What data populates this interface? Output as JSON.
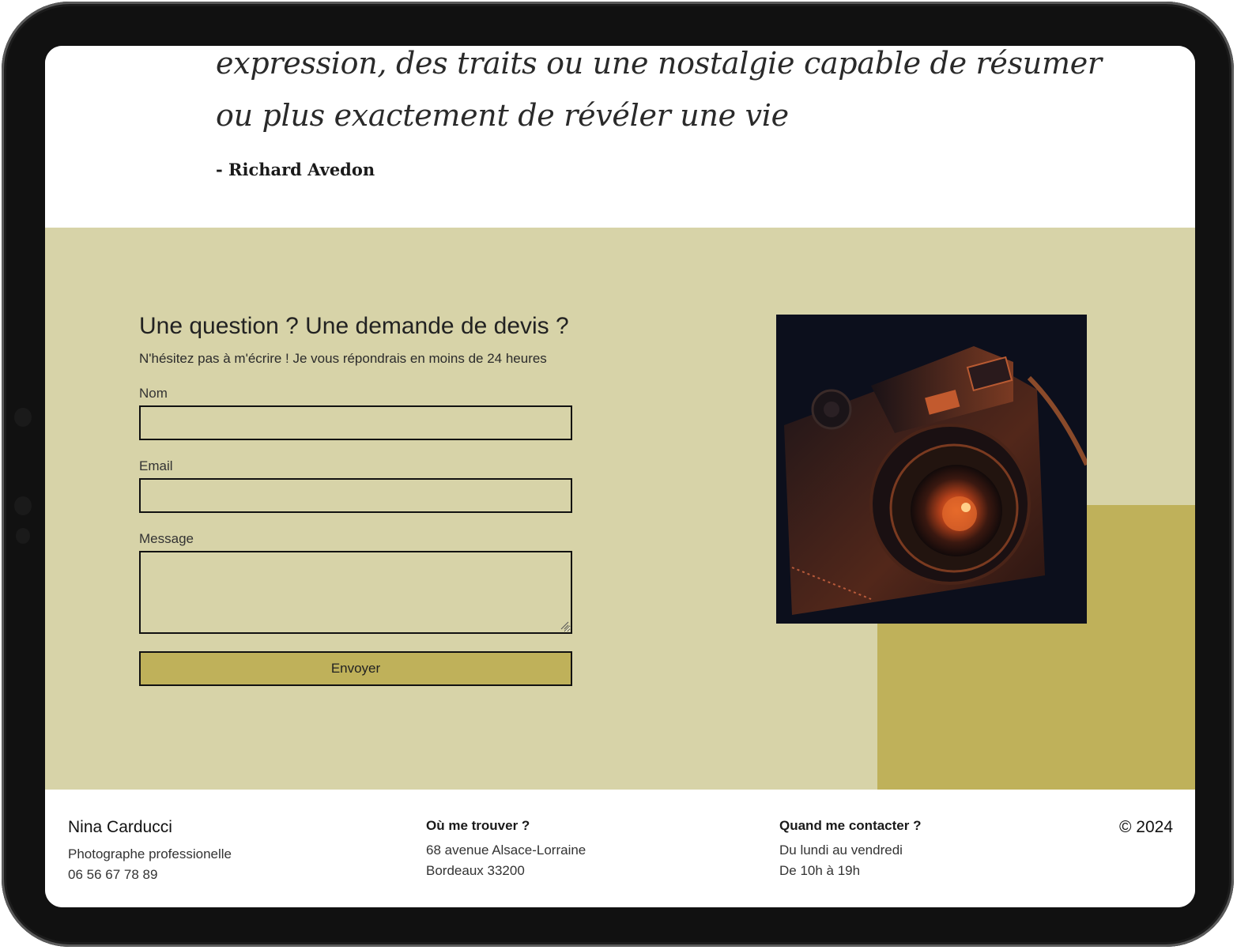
{
  "quote": {
    "line1": "expression, des traits ou une nostalgie capable de résumer",
    "line2": "ou plus exactement de révéler une vie",
    "author": "- Richard Avedon"
  },
  "contact": {
    "title": "Une question ? Une demande de devis ?",
    "subtitle": "N'hésitez pas à m'écrire ! Je vous répondrais en moins de 24 heures",
    "fields": [
      {
        "label": "Nom",
        "value": ""
      },
      {
        "label": "Email",
        "value": ""
      },
      {
        "label": "Message",
        "value": ""
      }
    ],
    "submit_label": "Envoyer"
  },
  "footer": {
    "name": "Nina Carducci",
    "role": "Photographe professionelle",
    "phone": "06 56 67 78 89",
    "location_heading": "Où me trouver ?",
    "address_line1": "68 avenue Alsace-Lorraine",
    "address_line2": "Bordeaux 33200",
    "hours_heading": "Quand me contacter ?",
    "hours_line1": "Du lundi au vendredi",
    "hours_line2": "De 10h à 19h",
    "copyright": "© 2024"
  },
  "colors": {
    "contact_background": "#d7d3a8",
    "accent": "#bfb15a",
    "device_frame": "#111111"
  },
  "icons": [
    "camera-photo",
    "resize-grip-icon"
  ]
}
